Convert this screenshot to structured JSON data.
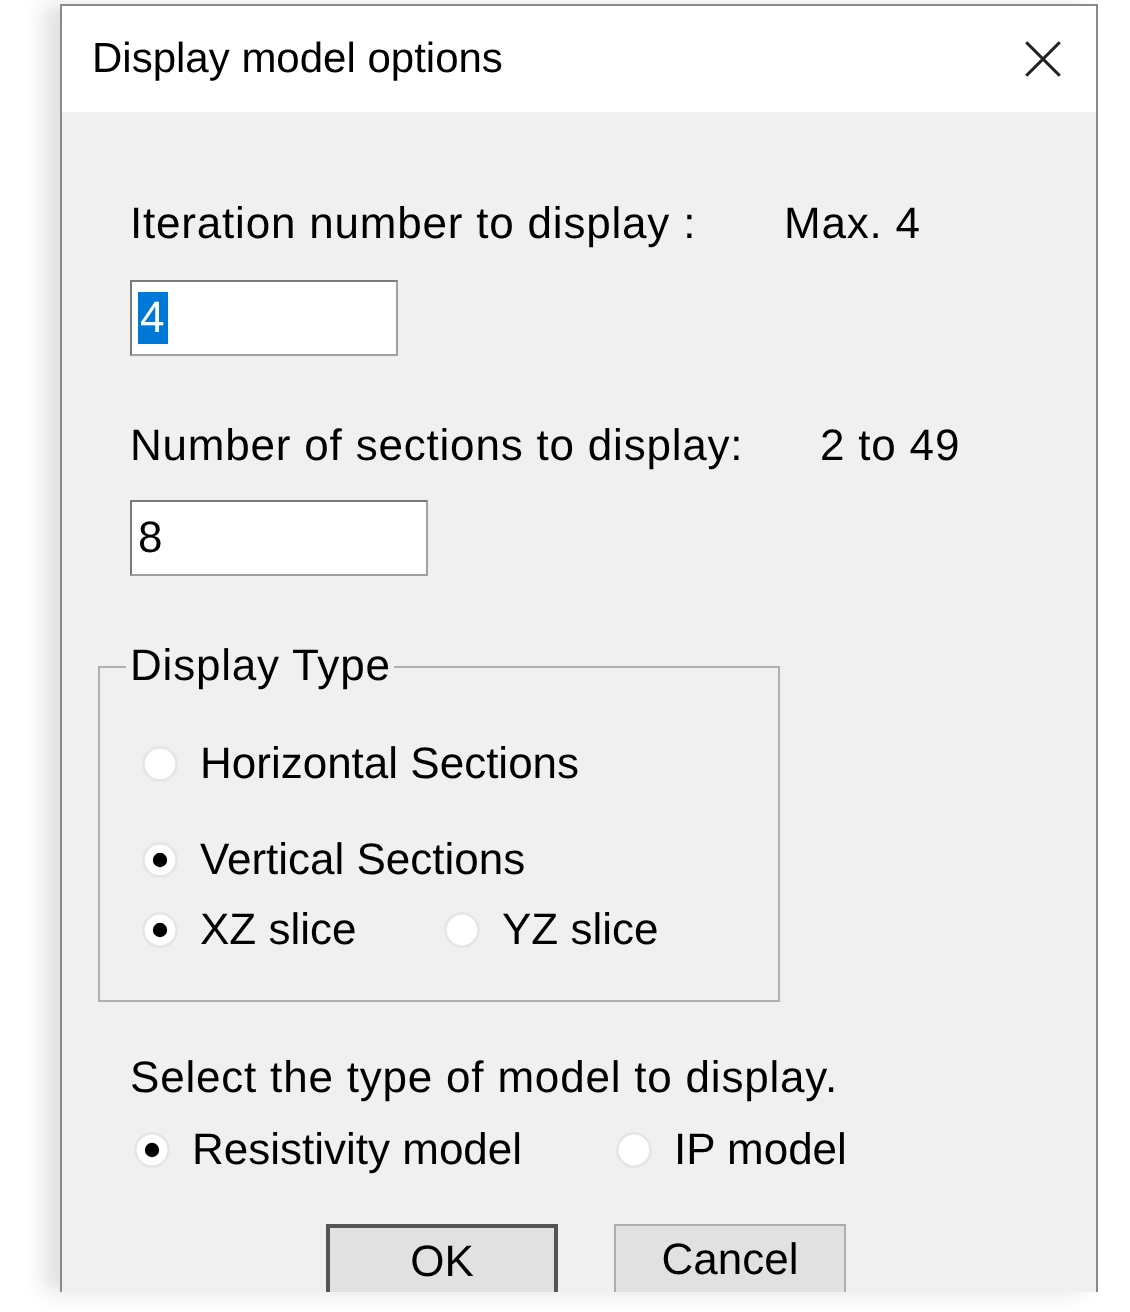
{
  "window": {
    "title": "Display model options"
  },
  "iteration": {
    "label": "Iteration number to display :",
    "hint": "Max. 4",
    "value": "4",
    "text_selected": true
  },
  "sections": {
    "label": "Number of sections to display:",
    "hint": "2 to 49",
    "value": "8",
    "text_selected": false
  },
  "display_type": {
    "legend": "Display Type",
    "options": [
      {
        "label": "Horizontal Sections",
        "selected": false
      },
      {
        "label": "Vertical Sections",
        "selected": true
      }
    ],
    "slices": [
      {
        "label": "XZ slice",
        "selected": true
      },
      {
        "label": "YZ slice",
        "selected": false
      }
    ]
  },
  "model_type": {
    "prompt": "Select the type of model to display.",
    "options": [
      {
        "label": "Resistivity model",
        "selected": true
      },
      {
        "label": "IP model",
        "selected": false
      }
    ]
  },
  "buttons": [
    {
      "label": "OK",
      "default": true
    },
    {
      "label": "Cancel",
      "default": false
    }
  ]
}
